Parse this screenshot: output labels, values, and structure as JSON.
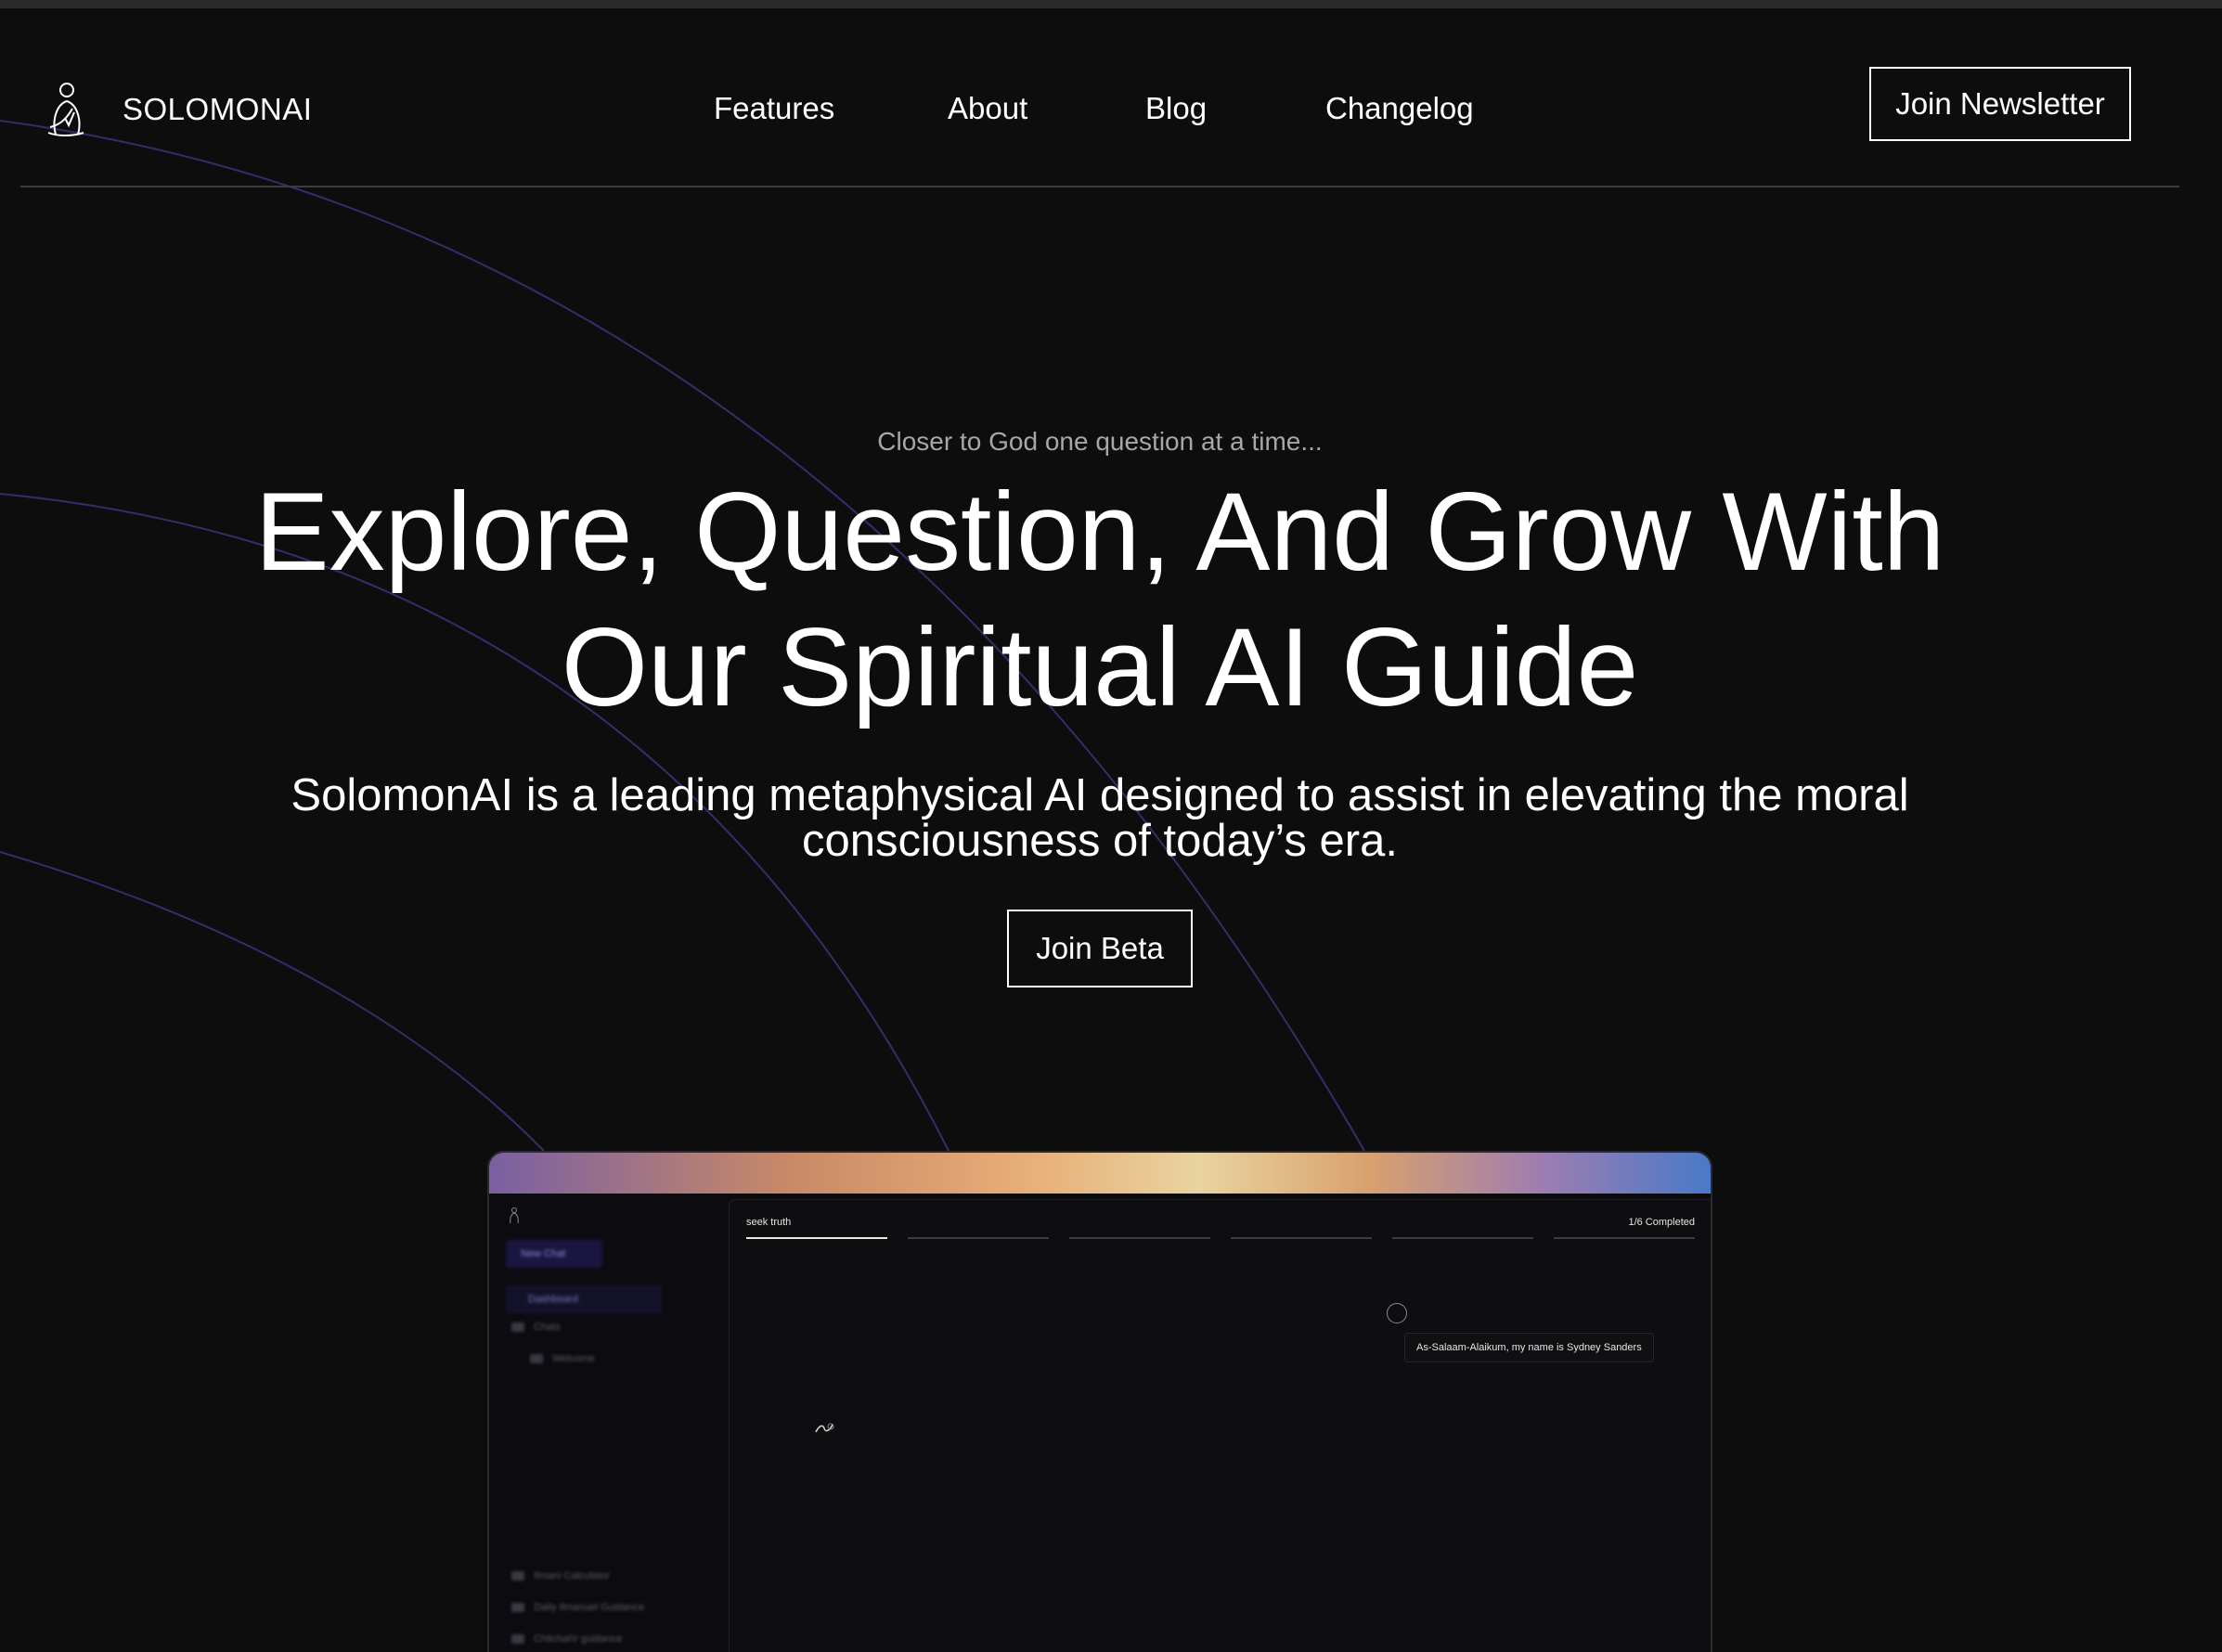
{
  "brand": {
    "name": "SOLOMONAI"
  },
  "nav": {
    "links": [
      "Features",
      "About",
      "Blog",
      "Changelog"
    ],
    "cta_label": "Join Newsletter"
  },
  "hero": {
    "eyebrow": "Closer to God one question at a time...",
    "title_line1": "Explore, Question, And Grow With",
    "title_line2": "Our Spiritual AI Guide",
    "subtitle_line1": "SolomonAI is a leading metaphysical AI designed to assist in elevating the moral",
    "subtitle_line2": "consciousness of today’s era.",
    "cta_label": "Join Beta"
  },
  "preview": {
    "sidebar": {
      "new_chat": "New Chat",
      "dashboard": "Dashboard",
      "items_top": [
        "Chats",
        "Welcome"
      ],
      "items_bottom": [
        "Ilmani Calculator",
        "Daily Ilmanuel Guidance",
        "ChitchatV guidance"
      ]
    },
    "chat": {
      "step_label": "seek truth",
      "progress_text": "1/6 Completed",
      "progress": {
        "completed": 1,
        "total": 6
      },
      "message": "As-Salaam-Alaikum, my name is Sydney Sanders"
    }
  },
  "colors": {
    "background": "#0d0d0e",
    "text": "#ffffff",
    "muted_text": "#a7a7aa",
    "arc_accent": "#3b2a6b",
    "divider": "#3d3d40"
  }
}
